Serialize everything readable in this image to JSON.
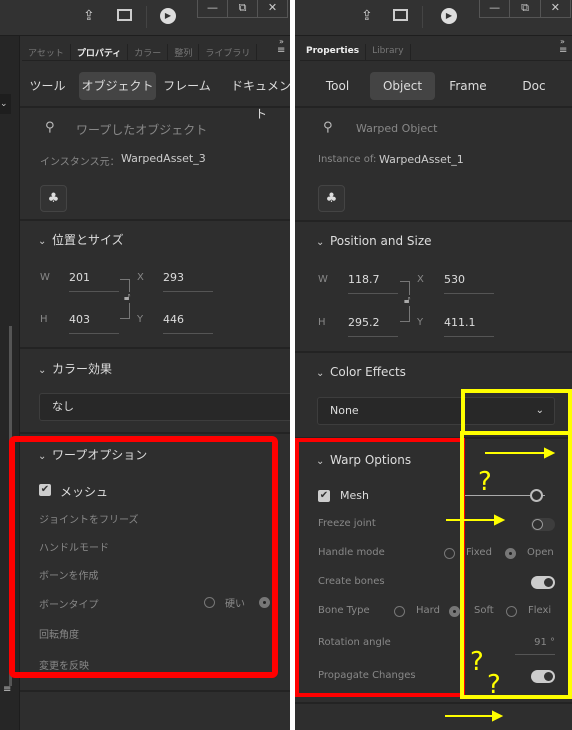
{
  "left_panel": {
    "panel_tabs": [
      "アセット",
      "プロパティ",
      "カラー",
      "整列",
      "ライブラリ"
    ],
    "active_panel_tab": "プロパティ",
    "sub_tabs": [
      "ツール",
      "オブジェクト",
      "フレーム",
      "ドキュメント"
    ],
    "active_sub_tab": "オブジェクト",
    "object_type": "ワープしたオブジェクト",
    "instance_label": "インスタンス元：",
    "instance_value": "WarpedAsset_3",
    "position_section": "位置とサイズ",
    "w_label": "W",
    "w_value": "201",
    "h_label": "H",
    "h_value": "403",
    "x_label": "X",
    "x_value": "293",
    "y_label": "Y",
    "y_value": "446",
    "color_section": "カラー効果",
    "color_effect_value": "なし",
    "warp_section": "ワープオプション",
    "mesh_label": "メッシュ",
    "freeze_joint": "ジョイントをフリーズ",
    "handle_mode": "ハンドルモード",
    "create_bones": "ボーンを作成",
    "bone_type": "ボーンタイプ",
    "bone_hard": "硬い",
    "rotation_angle": "回転角度",
    "propagate": "変更を反映"
  },
  "right_panel": {
    "panel_tabs": [
      "Properties",
      "Library"
    ],
    "active_panel_tab": "Properties",
    "sub_tabs": [
      "Tool",
      "Object",
      "Frame",
      "Doc"
    ],
    "active_sub_tab": "Object",
    "object_type": "Warped Object",
    "instance_label": "Instance of:",
    "instance_value": "WarpedAsset_1",
    "position_section": "Position and Size",
    "w_label": "W",
    "w_value": "118.7",
    "h_label": "H",
    "h_value": "295.2",
    "x_label": "X",
    "x_value": "530",
    "y_label": "Y",
    "y_value": "411.1",
    "color_section": "Color Effects",
    "color_effect_value": "None",
    "warp_section": "Warp Options",
    "mesh_label": "Mesh",
    "mesh_checked": true,
    "freeze_joint": "Freeze joint",
    "freeze_joint_on": false,
    "handle_mode": "Handle mode",
    "handle_fixed": "Fixed",
    "handle_open": "Open",
    "handle_selected": "Open",
    "create_bones": "Create bones",
    "create_bones_on": true,
    "bone_type": "Bone Type",
    "bone_hard": "Hard",
    "bone_soft": "Soft",
    "bone_flexi": "Flexi",
    "bone_selected": "Soft",
    "rotation_angle": "Rotation angle",
    "rotation_value": "91 °",
    "propagate": "Propagate Changes",
    "propagate_on": true
  },
  "window_controls": {
    "minimize": "—",
    "restore": "⧉",
    "close": "✕"
  },
  "annotations": {
    "red": "#ff0000",
    "yellow": "#ffff00",
    "marks": [
      "?",
      "?",
      "?"
    ]
  }
}
